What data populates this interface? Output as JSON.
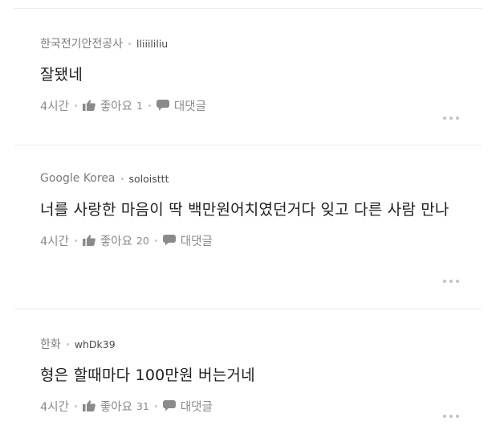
{
  "comments": [
    {
      "company": "한국전기안전공사",
      "user": "lliiililiu",
      "text": "잘됐네",
      "time": "4시간",
      "like_label": "좋아요",
      "like_count": "1",
      "reply_label": "대댓글"
    },
    {
      "company": "Google Korea",
      "user": "soloisttt",
      "text": "너를 사랑한 마음이 딱 백만원어치였던거다 잊고 다른 사람 만나",
      "time": "4시간",
      "like_label": "좋아요",
      "like_count": "20",
      "reply_label": "대댓글"
    },
    {
      "company": "한화",
      "user": "whDk39",
      "text": "형은 할때마다 100만원 버는거네",
      "time": "4시간",
      "like_label": "좋아요",
      "like_count": "31",
      "reply_label": "대댓글"
    }
  ],
  "icons": {
    "like": "thumbs-up-icon",
    "reply": "speech-bubble-icon",
    "more": "more-dots-icon"
  }
}
